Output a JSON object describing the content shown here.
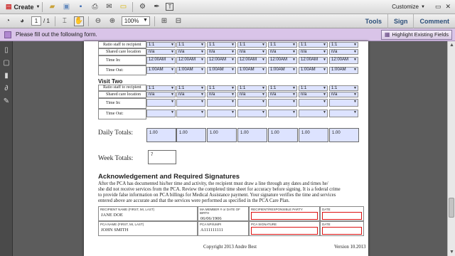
{
  "toolbar": {
    "create_label": "Create",
    "customize_label": "Customize",
    "current_page": "1",
    "page_total": "/ 1",
    "zoom": "100%"
  },
  "panel_tabs": [
    "Tools",
    "Sign",
    "Comment"
  ],
  "message_bar": {
    "text": "Please fill out the following form.",
    "highlight_button": "Highlight Existing Fields"
  },
  "form": {
    "visit1_rows": [
      {
        "label": "Ratio staff to recipient",
        "cells": [
          "1:1",
          "1:1",
          "1:1",
          "1:1",
          "1:1",
          "1:1",
          "1:1"
        ]
      },
      {
        "label": "Shared care location",
        "cells": [
          "n/a",
          "n/a",
          "n/a",
          "n/a",
          "n/a",
          "n/a",
          "n/a"
        ]
      },
      {
        "label": "Time In:",
        "cells": [
          "12:00AM",
          "12:00AM",
          "12:00AM",
          "12:00AM",
          "12:00AM",
          "12:00AM",
          "12:00AM"
        ]
      },
      {
        "label": "Time Out:",
        "cells": [
          "1:00AM",
          "1:00AM",
          "1:00AM",
          "1:00AM",
          "1:00AM",
          "1:00AM",
          "1:00AM"
        ]
      }
    ],
    "visit2_title": "Visit Two",
    "visit2_rows": [
      {
        "label": "Ratio staff to recipient",
        "cells": [
          "1:1",
          "1:1",
          "1:1",
          "1:1",
          "1:1",
          "1:1",
          "1:1"
        ]
      },
      {
        "label": "Shared care location",
        "cells": [
          "n/a",
          "n/a",
          "n/a",
          "n/a",
          "n/a",
          "n/a",
          "n/a"
        ]
      },
      {
        "label": "Time In:",
        "cells": [
          "",
          "",
          "",
          "",
          "",
          "",
          ""
        ]
      },
      {
        "label": "Time Out:",
        "cells": [
          "",
          "",
          "",
          "",
          "",
          "",
          ""
        ]
      }
    ],
    "daily_totals_label": "Daily Totals:",
    "daily_totals": [
      "1.00",
      "1.00",
      "1.00",
      "1.00",
      "1.00",
      "1.00",
      "1.00"
    ],
    "week_totals_label": "Week Totals:",
    "week_total": "7",
    "ack_title": "Acknowledgement and Required Signatures",
    "ack_lines": [
      "After the PCA has documented his/her time and activity, the recipient must draw a line through any dates and times he/",
      "she did not receive services from the PCA. Review the completed time sheet for accuracy before signing. It is a federal crime",
      "to provide false information on PCA billings for Medical Assistance payment. Your signature verifies the time and services",
      "entered above are accurate and that the services were performed as specified in the PCA Care Plan."
    ],
    "recipient_name_label": "RECIPIENT NAME (FIRST, MI, LAST)",
    "recipient_name": "JANE DOE",
    "ma_label": "MA MEMBER # or DATE OF BIRTH",
    "ma_value": "06/06/1906",
    "resp_sig_label": "RECIPIENT/RESPONSIBLE PARTY SIGNATURE",
    "date_label": "DATE",
    "pca_name_label": "PCA NAME (FIRST, MI, LAST)",
    "pca_name": "JOHN SMITH",
    "npi_label": "PCA NPI/UMPI",
    "npi_value": "A111111111",
    "pca_sig_label": "PCA SIGNATURE",
    "date_label2": "DATE",
    "copyright": "Copyright 2013 Andre Best",
    "version": "Version 10.2013"
  }
}
